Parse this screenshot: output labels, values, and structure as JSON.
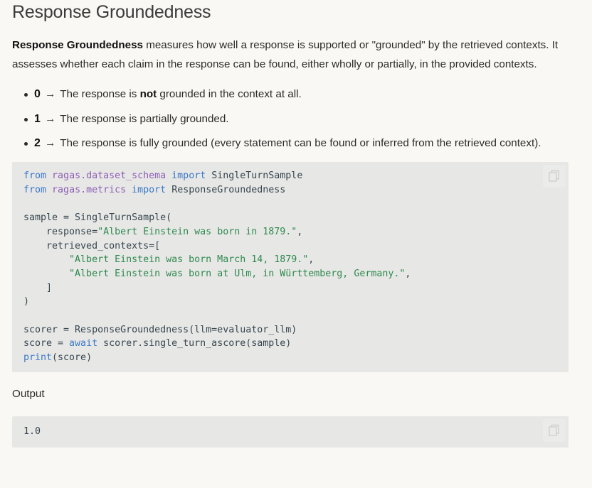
{
  "section": {
    "title": "Response Groundedness"
  },
  "intro": {
    "term": "Response Groundedness",
    "text": " measures how well a response is supported or \"grounded\" by the retrieved contexts. It assesses whether each claim in the response can be found, either wholly or partially, in the provided contexts."
  },
  "levels": [
    {
      "score": "0",
      "arrow": "→",
      "before": " The response is ",
      "emphasis": "not",
      "after": " grounded in the context at all."
    },
    {
      "score": "1",
      "arrow": "→",
      "before": " The response is partially grounded.",
      "emphasis": "",
      "after": ""
    },
    {
      "score": "2",
      "arrow": "→",
      "before": " The response is fully grounded (every statement can be found or inferred from the retrieved context).",
      "emphasis": "",
      "after": ""
    }
  ],
  "code": {
    "kw_from": "from",
    "kw_import": "import",
    "kw_await": "await",
    "mod_schema": "ragas.dataset_schema",
    "mod_metrics": "ragas.metrics",
    "cls_sample": "SingleTurnSample",
    "cls_metric": "ResponseGroundedness",
    "line_sample_open": "sample = SingleTurnSample(",
    "arg_response": "    response=",
    "str_response": "\"Albert Einstein was born in 1879.\"",
    "comma": ",",
    "arg_contexts": "    retrieved_contexts=[",
    "str_ctx1": "        \"Albert Einstein was born March 14, 1879.\"",
    "str_ctx2": "        \"Albert Einstein was born at Ulm, in Württemberg, Germany.\"",
    "close_bracket": "    ]",
    "close_paren": ")",
    "line_scorer": "scorer = ResponseGroundedness(llm=evaluator_llm)",
    "line_score_pre": "score = ",
    "line_score_post": " scorer.single_turn_ascore(sample)",
    "fn_print": "print",
    "print_args": "(score)"
  },
  "output": {
    "label": "Output",
    "value": "1.0"
  },
  "icons": {
    "copy": "copy-icon"
  },
  "colors": {
    "background": "#f9f8f4",
    "code_background": "#e7e7e6",
    "keyword": "#3b79c7",
    "module": "#8e5fb5",
    "string": "#2e8a4e"
  }
}
